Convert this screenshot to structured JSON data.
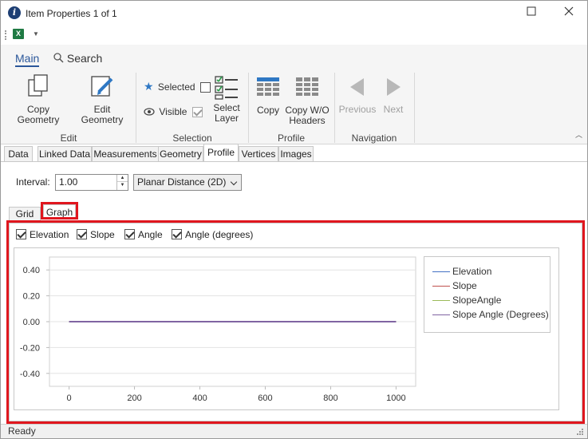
{
  "window": {
    "title": "Item Properties 1 of 1"
  },
  "ribbon": {
    "tabs": [
      {
        "label": "Main",
        "active": true
      },
      {
        "label": "Search",
        "active": false
      }
    ],
    "edit": {
      "group_label": "Edit",
      "copy_geometry": "Copy Geometry",
      "edit_geometry": "Edit Geometry"
    },
    "selection": {
      "group_label": "Selection",
      "selected_label": "Selected",
      "selected_checked": false,
      "visible_label": "Visible",
      "visible_checked": true,
      "select_layer_line1": "Select",
      "select_layer_line2": "Layer"
    },
    "profile": {
      "group_label": "Profile",
      "copy": "Copy",
      "copy_wo_line1": "Copy W/O",
      "copy_wo_line2": "Headers"
    },
    "navigation": {
      "group_label": "Navigation",
      "previous": "Previous",
      "next": "Next"
    }
  },
  "tabs": [
    "Data",
    "Linked Data",
    "Measurements",
    "Geometry",
    "Profile",
    "Vertices",
    "Images"
  ],
  "active_tab": "Profile",
  "interval": {
    "label": "Interval:",
    "value": "1.00"
  },
  "distance_mode": {
    "selected": "Planar Distance (2D)"
  },
  "subtabs": [
    "Grid",
    "Graph"
  ],
  "active_subtab": "Graph",
  "series_toggles": [
    {
      "label": "Elevation",
      "checked": true
    },
    {
      "label": "Slope",
      "checked": true
    },
    {
      "label": "Angle",
      "checked": true
    },
    {
      "label": "Angle (degrees)",
      "checked": true
    }
  ],
  "legend": [
    {
      "label": "Elevation",
      "color": "#4472c4"
    },
    {
      "label": "Slope",
      "color": "#c0504d"
    },
    {
      "label": "SlopeAngle",
      "color": "#9bbb59"
    },
    {
      "label": "Slope Angle (Degrees)",
      "color": "#8064a2"
    }
  ],
  "chart_data": {
    "type": "line",
    "title": "",
    "xlabel": "",
    "ylabel": "",
    "xlim": [
      -60,
      1060
    ],
    "ylim": [
      -0.5,
      0.5
    ],
    "x_ticks": [
      0,
      200,
      400,
      600,
      800,
      1000
    ],
    "y_ticks": [
      0.4,
      0.2,
      0.0,
      -0.2,
      -0.4
    ],
    "y_tick_labels": [
      "0.40",
      "0.20",
      "0.00",
      "-0.20",
      "-0.40"
    ],
    "grid": true,
    "legend_position": "top-right",
    "series": [
      {
        "name": "Elevation",
        "color": "#4472c4",
        "x": [
          0,
          1000
        ],
        "y": [
          0,
          0
        ]
      },
      {
        "name": "Slope",
        "color": "#c0504d",
        "x": [
          0,
          1000
        ],
        "y": [
          0,
          0
        ]
      },
      {
        "name": "SlopeAngle",
        "color": "#9bbb59",
        "x": [
          0,
          1000
        ],
        "y": [
          0,
          0
        ]
      },
      {
        "name": "Slope Angle (Degrees)",
        "color": "#8064a2",
        "x": [
          0,
          1000
        ],
        "y": [
          0,
          0
        ]
      }
    ]
  },
  "status": {
    "text": "Ready"
  }
}
